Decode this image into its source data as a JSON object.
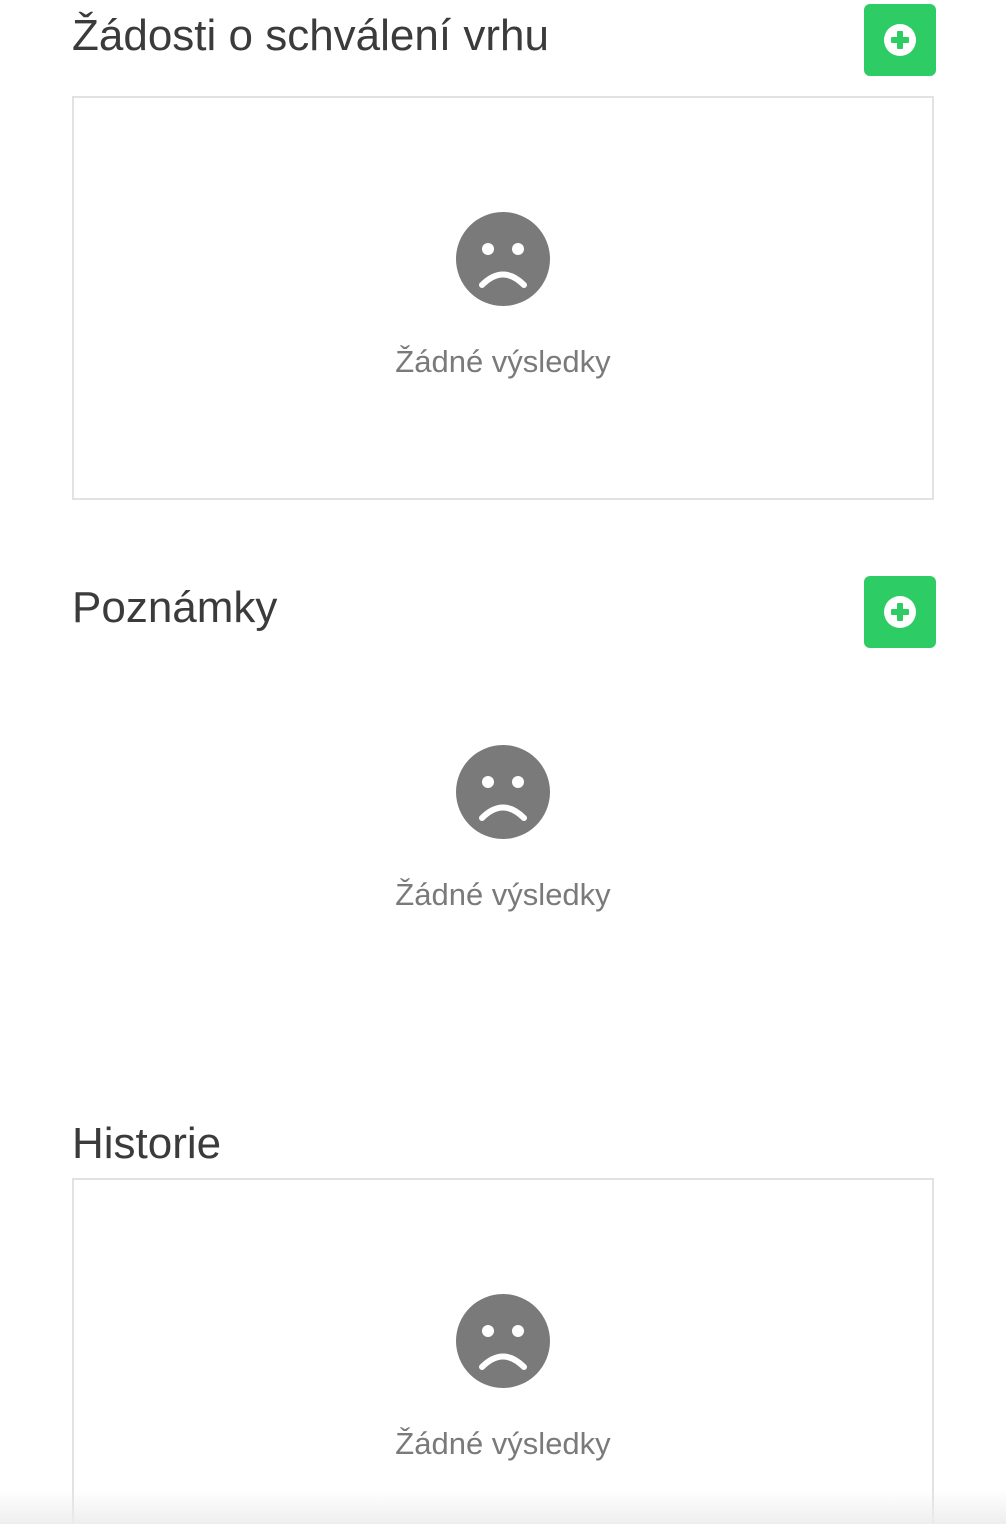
{
  "colors": {
    "accent": "#2ecc64",
    "icon_gray": "#7a7a7a",
    "border": "#e2e2e2"
  },
  "sections": {
    "approvals": {
      "title": "Žádosti o schválení vrhu",
      "add_icon": "plus-circle-icon",
      "empty_icon": "sad-face-icon",
      "empty_text": "Žádné výsledky"
    },
    "notes": {
      "title": "Poznámky",
      "add_icon": "plus-circle-icon",
      "empty_icon": "sad-face-icon",
      "empty_text": "Žádné výsledky"
    },
    "history": {
      "title": "Historie",
      "empty_icon": "sad-face-icon",
      "empty_text": "Žádné výsledky"
    }
  }
}
